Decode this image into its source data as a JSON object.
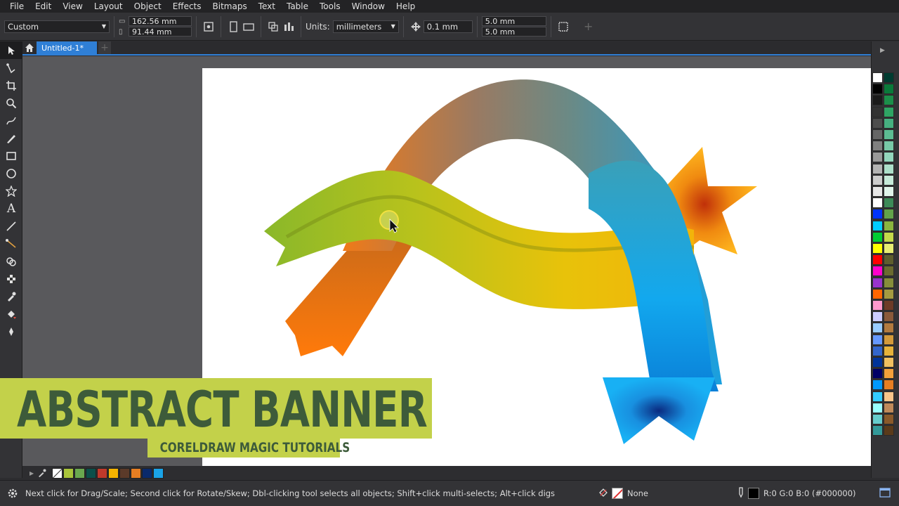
{
  "menu": [
    "File",
    "Edit",
    "View",
    "Layout",
    "Object",
    "Effects",
    "Bitmaps",
    "Text",
    "Table",
    "Tools",
    "Window",
    "Help"
  ],
  "propbar": {
    "preset": "Custom",
    "width": "162.56 mm",
    "height": "91.44 mm",
    "units_label": "Units:",
    "units": "millimeters",
    "nudge": "0.1 mm",
    "dup_x": "5.0 mm",
    "dup_y": "5.0 mm"
  },
  "tab": {
    "title": "Untitled-1*"
  },
  "banner": {
    "title": "ABSTRACT BANNER",
    "subtitle": "CORELDRAW MAGIC TUTORIALS"
  },
  "status": {
    "hint": "Next click for Drag/Scale; Second click for Rotate/Skew; Dbl-clicking tool selects all objects; Shift+click multi-selects; Alt+click digs",
    "fill_label": "None",
    "outline_label": "R:0 G:0 B:0 (#000000)"
  },
  "palette_colors": [
    "#ffffff",
    "#003b30",
    "#000000",
    "#0a7a3a",
    "#1a1a1a",
    "#1c8f4a",
    "#333333",
    "#2fa564",
    "#4d4d4d",
    "#46b080",
    "#666666",
    "#5cbc92",
    "#808080",
    "#77c9a7",
    "#999999",
    "#93d6bc",
    "#b3b3b3",
    "#acdfc9",
    "#cccccc",
    "#c6ead9",
    "#e6e6e6",
    "#e0f4ea",
    "#ffffff",
    "#3d8a58",
    "#0033ff",
    "#62a34a",
    "#00ccff",
    "#8ab53e",
    "#00cc33",
    "#c4d94a",
    "#ffff00",
    "#e7ed73",
    "#ff0000",
    "#5e5e2e",
    "#ff00cc",
    "#6b6b30",
    "#9933cc",
    "#868e3a",
    "#ff6600",
    "#a49a40",
    "#ff99cc",
    "#6d3b27",
    "#ccccff",
    "#8a5a3a",
    "#99ccff",
    "#b27a3e",
    "#6699ff",
    "#d49a3a",
    "#3366cc",
    "#e6b23a",
    "#003399",
    "#f0c060",
    "#000066",
    "#f2a03a",
    "#0099ff",
    "#e67e22",
    "#33ccff",
    "#f8c58a",
    "#99ffff",
    "#c08a5a",
    "#66cccc",
    "#8a5a2a",
    "#339999",
    "#5a3a1a"
  ],
  "doc_palette": [
    "#ffffff",
    "#a9c43a",
    "#6aa84f",
    "#0b4f4a",
    "#c0392b",
    "#f5b400",
    "#5b3a29",
    "#e67e22",
    "#0a2a6b",
    "#1aa3e8"
  ]
}
